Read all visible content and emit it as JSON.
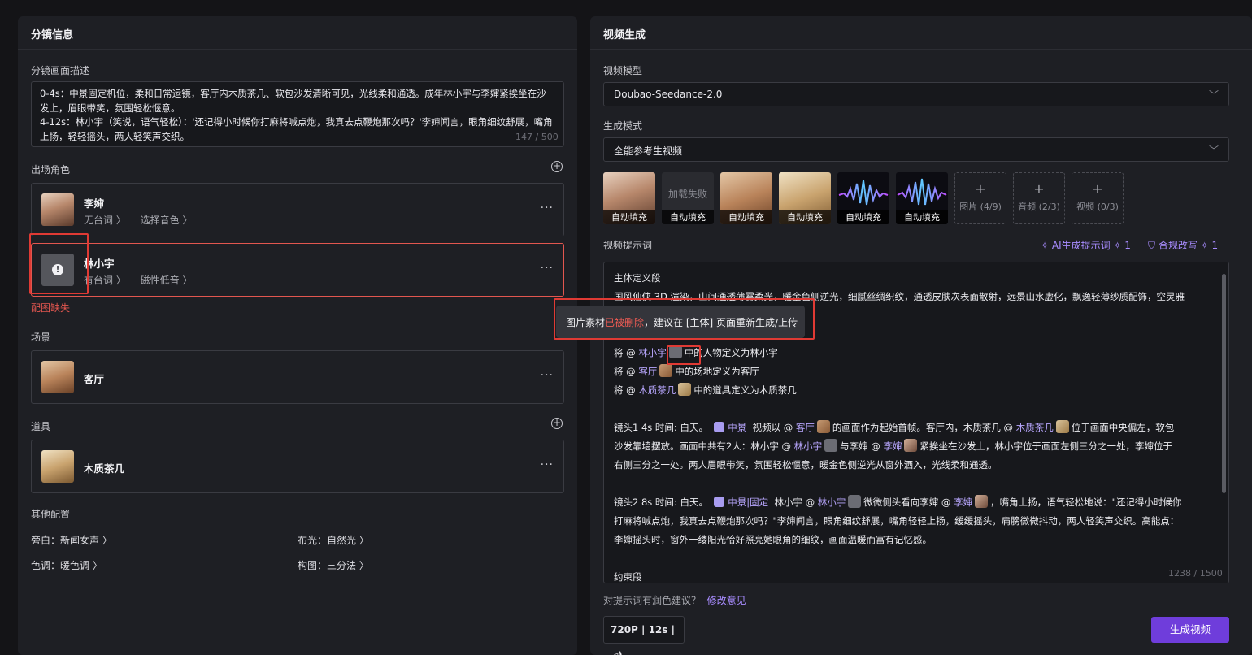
{
  "left_panel": {
    "title": "分镜信息",
    "desc_label": "分镜画面描述",
    "desc_text_1": "0-4s：中景固定机位，柔和日常运镜，客厅内木质茶几、软包沙发清晰可见，光线柔和通透。成年林小宇与李婶紧挨坐在沙发上，眉眼带笑，氛围轻松惬意。",
    "desc_text_2": "4-12s：林小宇（笑说，语气轻松）：'还记得小时候你打麻将喊点炮，我真去点鞭炮那次吗？'李婶闻言，眼角细纹舒展，嘴角上扬，轻轻摇头，两人轻笑声交织。",
    "desc_counter": "147 / 500",
    "characters_label": "出场角色",
    "characters": [
      {
        "name": "李婶",
        "dialog": "无台词 〉",
        "voice": "选择音色 〉"
      },
      {
        "name": "林小宇",
        "dialog": "有台词 〉",
        "voice": "磁性低音 〉"
      }
    ],
    "missing_image": "配图缺失",
    "scene_label": "场景",
    "scene_name": "客厅",
    "prop_label": "道具",
    "prop_name": "木质茶几",
    "other_label": "其他配置",
    "narration": "旁白：新闻女声 〉",
    "lighting": "布光：自然光 〉",
    "color_tone": "色调：暖色调 〉",
    "composition": "构图：三分法 〉"
  },
  "right_panel": {
    "title": "视频生成",
    "model_label": "视频模型",
    "model_value": "Doubao-Seedance-2.0",
    "mode_label": "生成模式",
    "mode_value": "全能参考生视频",
    "media": {
      "auto_fill": "自动填充",
      "load_failed": "加载失败",
      "image_slot": "图片 (4/9)",
      "audio_slot": "音频 (2/3)",
      "video_slot": "视频 (0/3)"
    },
    "prompt_label": "视频提示词",
    "ai_prompt": "AI生成提示词 ✧ 1",
    "compliance": "合规改写 ✧ 1",
    "prompt": {
      "section1": "主体定义段",
      "line1": "国风仙侠 3D 渲染，山间通透薄雾柔光，暖金色侧逆光，细腻丝绸织纹，通透皮肤次表面散射，远景山水虚化，飘逸轻薄纱质配饰，空灵雅",
      "def_prefix": "将 @",
      "def1_name": "林小宇",
      "def1_suffix": "中的人物定义为林小宇",
      "def2_name": "客厅",
      "def2_suffix": "中的场地定义为客厅",
      "def3_name": "木质茶几",
      "def3_suffix": "中的道具定义为木质茶几",
      "shot1_head": "镜头1 4s 时间: 白天。",
      "shot1_tag": "中景",
      "shot1_a": "视频以 @",
      "shot1_b": "的画面作为起始首帧。客厅内，木质茶几 @",
      "shot1_c": "位于画面中央偏左，软包",
      "shot1_line2a": "沙发靠墙摆放。画面中共有2人：林小宇 @",
      "shot1_line2b": "与李婶 @",
      "shot1_line2c": "紧挨坐在沙发上，林小宇位于画面左侧三分之一处，李婶位于",
      "shot1_line3": "右侧三分之一处。两人眉眼带笑，氛围轻松惬意，暖金色侧逆光从窗外洒入，光线柔和通透。",
      "shot2_head": "镜头2 8s 时间: 白天。",
      "shot2_tag": "中景|固定",
      "shot2_a": "林小宇 @",
      "shot2_b": "微微侧头看向李婶 @",
      "shot2_c": "，嘴角上扬，语气轻松地说：\"还记得小时候你",
      "shot2_line2": "打麻将喊点炮，我真去点鞭炮那次吗？\"李婶闻言，眼角细纹舒展，嘴角轻轻上扬，缓缓摇头，肩膀微微抖动，两人轻笑声交织。高能点：",
      "shot2_line3": "李婶摇头时，窗外一缕阳光恰好照亮她眼角的细纹，画面温暖而富有记忆感。",
      "section_end": "约束段",
      "mention_lxy": "林小宇",
      "mention_lishen": "李婶",
      "mention_keting": "客厅",
      "mention_chaji": "木质茶几"
    },
    "prompt_counter": "1238 / 1500",
    "tooltip_a": "图片素材",
    "tooltip_deleted": "已被删除",
    "tooltip_b": "，建议在 [主体] 页面重新生成/上传",
    "suggestion": "对提示词有润色建议？",
    "suggestion_link": "修改意见",
    "resolution": "720P | 12s | ◁)",
    "generate_button": "生成视频"
  }
}
